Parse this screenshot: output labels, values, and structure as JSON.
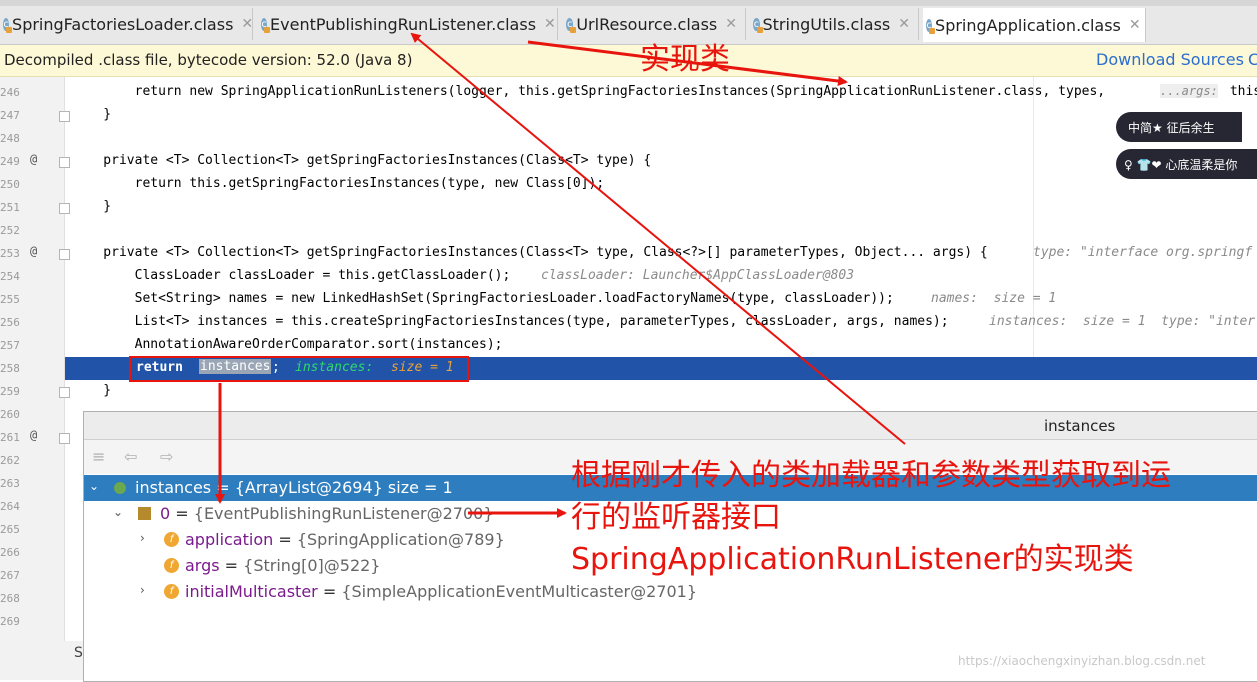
{
  "tabs": [
    {
      "label": "SpringFactoriesLoader.class",
      "active": false
    },
    {
      "label": "EventPublishingRunListener.class",
      "active": false
    },
    {
      "label": "UrlResource.class",
      "active": false
    },
    {
      "label": "StringUtils.class",
      "active": false
    },
    {
      "label": "SpringApplication.class",
      "active": true
    }
  ],
  "banner": {
    "message": "Decompiled .class file, bytecode version: 52.0 (Java 8)",
    "download_sources": "Download Sources",
    "cut_text": "C"
  },
  "gutter": {
    "line_numbers": [
      "246",
      "247",
      "248",
      "249",
      "250",
      "251",
      "252",
      "253",
      "254",
      "255",
      "256",
      "257",
      "258",
      "259",
      "260",
      "261",
      "262",
      "263",
      "264",
      "265",
      "266",
      "267",
      "268",
      "269"
    ],
    "override_marks": [
      "@",
      "@",
      "@"
    ]
  },
  "code_lines": {
    "l246_a": "        return new SpringApplicationRunListeners(logger, this.getSpringFactoriesInstances(SpringApplicationRunListener.class, types, ",
    "l246_args": "...args:",
    "l246_b": " this,",
    "l247": "    }",
    "l249": "    private <T> Collection<T> getSpringFactoriesInstances(Class<T> type) {",
    "l250": "        return this.getSpringFactoriesInstances(type, new Class[0]);",
    "l251": "    }",
    "l253": "    private <T> Collection<T> getSpringFactoriesInstances(Class<T> type, Class<?>[] parameterTypes, Object... args) {",
    "l253_hint": "type: \"interface org.springf",
    "l254": "        ClassLoader classLoader = this.getClassLoader();",
    "l254_hint": "classLoader: Launcher$AppClassLoader@803",
    "l255": "        Set<String> names = new LinkedHashSet(SpringFactoriesLoader.loadFactoryNames(type, classLoader));",
    "l255_hint": "names:  size = 1",
    "l256": "        List<T> instances = this.createSpringFactoriesInstances(type, parameterTypes, classLoader, args, names);",
    "l256_hint": "instances:  size = 1  type: \"inter",
    "l257": "        AnnotationAwareOrderComparator.sort(instances);",
    "l258_kw": "return",
    "l258_var": "instances",
    "l258_semi": ";",
    "l258_hint_name": "instances:",
    "l258_hint_val": "size = 1",
    "l259": "    }"
  },
  "debug_panel": {
    "title": "instances",
    "toolbar": [
      "≡",
      "⇦",
      "⇨"
    ],
    "rows": [
      {
        "arrow": "⌄",
        "name": "instances",
        "eq": " = ",
        "value": "{ArrayList@2694}  size = 1"
      },
      {
        "arrow": "⌄",
        "name": "0",
        "eq": " = ",
        "value": "{EventPublishingRunListener@2700}"
      },
      {
        "arrow": "›",
        "icon": "f",
        "name": "application",
        "eq": " = ",
        "value": "{SpringApplication@789}"
      },
      {
        "arrow": "",
        "icon": "f",
        "name": "args",
        "eq": " = ",
        "value": "{String[0]@522}"
      },
      {
        "arrow": "›",
        "icon": "f",
        "name": "initialMulticaster",
        "eq": " = ",
        "value": "{SimpleApplicationEventMulticaster@2701}"
      }
    ]
  },
  "annotations": {
    "impl_class": "实现类",
    "desc_line1": "根据刚才传入的类加载器和参数类型获取到运",
    "desc_line2": "行的监听器接口",
    "desc_line3": "SpringApplicationRunListener的实现类"
  },
  "widgets": {
    "top": "中简★ 征后余生",
    "bottom": "♀ 👕❤ 心底温柔是你"
  },
  "watermark": "https://xiaochengxinyizhan.blog.csdn.net",
  "status_cut": "S",
  "colors": {
    "annotation_red": "#e8140e",
    "selection_blue": "#2154a9",
    "banner_bg": "#fdf8d5"
  }
}
